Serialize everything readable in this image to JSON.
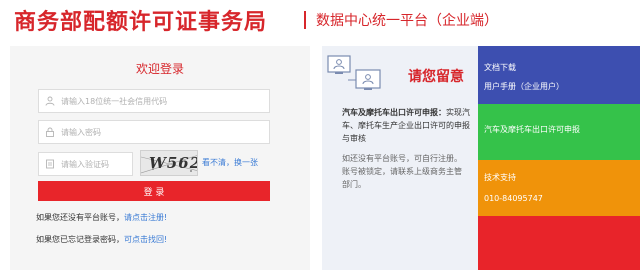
{
  "header": {
    "title": "商务部配额许可证事务局",
    "subtitle": "数据中心统一平台（企业端）"
  },
  "login": {
    "title": "欢迎登录",
    "username_placeholder": "请输入18位统一社会信用代码",
    "password_placeholder": "请输入密码",
    "captcha_placeholder": "请输入验证码",
    "captcha_text": "W562",
    "captcha_refresh": "看不清，换一张",
    "submit_label": "登 录",
    "register_prompt": "如果您还没有平台账号，",
    "register_link": "请点击注册!",
    "forgot_prompt": "如果您已忘记登录密码，",
    "forgot_link": "可点击找回!"
  },
  "notice": {
    "heading": "请您留意",
    "para1_bold": "汽车及摩托车出口许可申报：",
    "para1_rest": "实现汽车、摩托车生产企业出口许可的申报与审核",
    "para2": "如还没有平台账号，可自行注册。账号被锁定，请联系上级商务主管部门。"
  },
  "tiles": {
    "blue": {
      "item1": "文档下载",
      "item2": "用户手册（企业用户）",
      "color": "#3d4fb0"
    },
    "green": {
      "item1": "汽车及摩托车出口许可申报",
      "color": "#35c24a"
    },
    "orange": {
      "item1": "技术支持",
      "item2": "010-84095747",
      "color": "#f0930a"
    },
    "red": {
      "color": "#e8242a"
    }
  },
  "colors": {
    "brand_red": "#d7262b",
    "link_blue": "#3a7bd5"
  }
}
